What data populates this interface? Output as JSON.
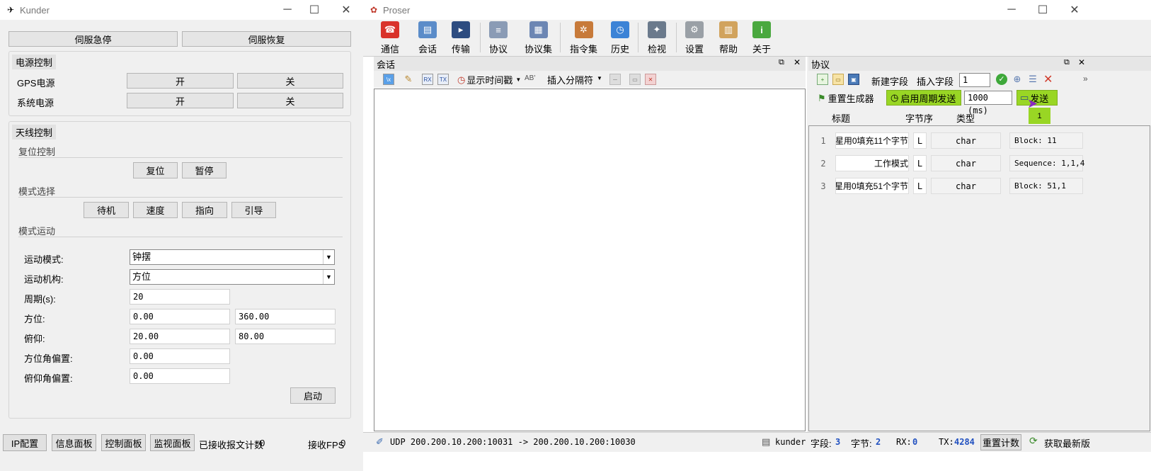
{
  "kunder": {
    "title": "Kunder",
    "top_buttons": [
      "伺服急停",
      "伺服恢复"
    ],
    "power": {
      "title": "电源控制",
      "rows": [
        {
          "label": "GPS电源",
          "on": "开",
          "off": "关"
        },
        {
          "label": "系统电源",
          "on": "开",
          "off": "关"
        }
      ]
    },
    "antenna": {
      "title": "天线控制",
      "reset_title": "复位控制",
      "reset_buttons": [
        "复位",
        "暂停"
      ],
      "mode_title": "模式选择",
      "mode_buttons": [
        "待机",
        "速度",
        "指向",
        "引导"
      ],
      "motion_title": "模式运动",
      "motion_mode_label": "运动模式:",
      "motion_mode_value": "钟摆",
      "mechanism_label": "运动机构:",
      "mechanism_value": "方位",
      "period_label": "周期(s):",
      "period_value": "20",
      "azimuth_label": "方位:",
      "azimuth_min": "0.00",
      "azimuth_max": "360.00",
      "elevation_label": "俯仰:",
      "elevation_min": "20.00",
      "elevation_max": "80.00",
      "az_offset_label": "方位角偏置:",
      "az_offset_value": "0.00",
      "el_offset_label": "俯仰角偏置:",
      "el_offset_value": "0.00",
      "start_button": "启动"
    },
    "status": {
      "tabs": [
        "IP配置",
        "信息面板",
        "控制面板",
        "监视面板"
      ],
      "received_label": "已接收报文计数",
      "received_value": "0",
      "fps_label": "接收FPS",
      "fps_value": "0"
    }
  },
  "proser": {
    "title": "Proser",
    "toolbar": [
      {
        "label": "通信",
        "icon": "telephone-icon",
        "color": "#d9332b",
        "glyph": "☎"
      },
      {
        "label": "会话",
        "icon": "session-icon",
        "color": "#5b8cc9",
        "glyph": "▤"
      },
      {
        "label": "传输",
        "icon": "terminal-icon",
        "color": "#2d4c80",
        "glyph": "▸"
      },
      {
        "label": "协议",
        "icon": "protocol-icon",
        "color": "#8a9bb5",
        "glyph": "≡"
      },
      {
        "label": "协议集",
        "icon": "protocol-set-icon",
        "color": "#6c86b3",
        "glyph": "▦"
      },
      {
        "label": "指令集",
        "icon": "ship-wheel-icon",
        "color": "#c77a3a",
        "glyph": "✲"
      },
      {
        "label": "历史",
        "icon": "clock-icon",
        "color": "#3c83d6",
        "glyph": "◷"
      },
      {
        "label": "检视",
        "icon": "magic-wand-icon",
        "color": "#6b7a8c",
        "glyph": "✦"
      },
      {
        "label": "设置",
        "icon": "gear-icon",
        "color": "#9aa0a6",
        "glyph": "⚙"
      },
      {
        "label": "帮助",
        "icon": "book-icon",
        "color": "#d1a35d",
        "glyph": "▥"
      },
      {
        "label": "关于",
        "icon": "info-icon",
        "color": "#4aa83f",
        "glyph": "i"
      }
    ],
    "session": {
      "title": "会话",
      "show_timestamp": "显示时间戳",
      "insert_separator": "插入分隔符"
    },
    "protocol": {
      "title": "协议",
      "new_field": "新建字段",
      "insert_field": "插入字段",
      "insert_index": "1",
      "reset_generator": "重置生成器",
      "enable_periodic": "启用周期发送",
      "period": "1000 (ms)",
      "send": "发送",
      "columns": [
        "标题",
        "字节序",
        "类型"
      ],
      "send_count": "1",
      "fields": [
        {
          "num": "1",
          "title": "星用0填充11个字节",
          "order": "L",
          "type": "char",
          "value": "Block: 11"
        },
        {
          "num": "2",
          "title": "工作模式",
          "order": "L",
          "type": "char",
          "value": "Sequence: 1,1,4"
        },
        {
          "num": "3",
          "title": "星用0填充51个字节",
          "order": "L",
          "type": "char",
          "value": "Block: 51,1"
        }
      ]
    },
    "status": {
      "connection": "UDP 200.200.10.200:10031 -> 200.200.10.200:10030",
      "user": "kunder",
      "field_label": "字段:",
      "field_value": "3",
      "byte_label": "字节:",
      "byte_value": "2",
      "rx_label": "RX:",
      "rx_value": "0",
      "tx_label": "TX:",
      "tx_value": "4284",
      "reset_count": "重置计数",
      "get_latest": "获取最新版"
    }
  }
}
